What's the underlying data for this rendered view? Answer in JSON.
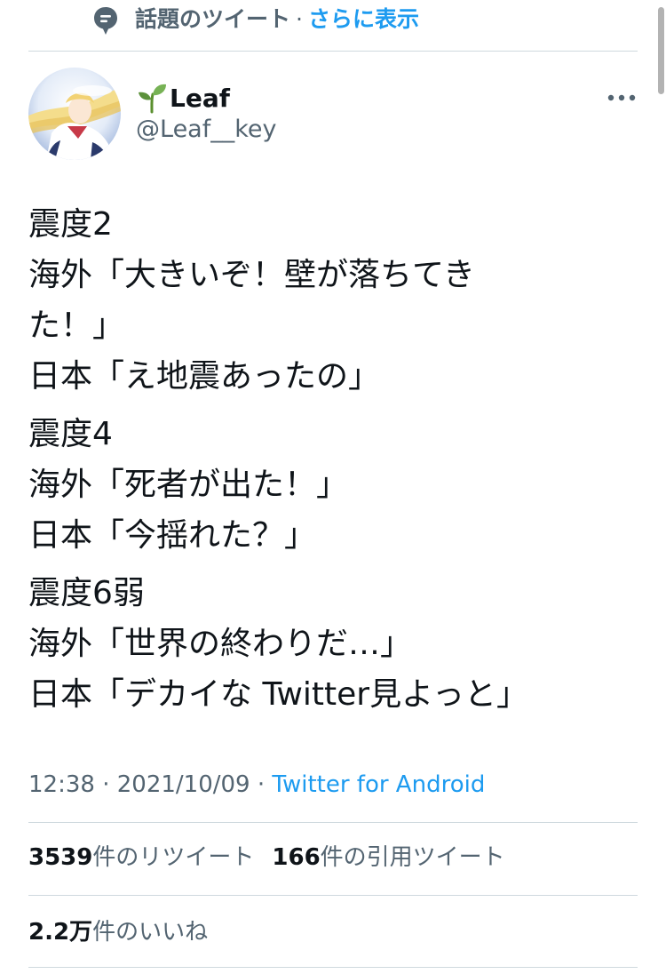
{
  "topic_bar": {
    "label": "話題のツイート",
    "separator": "·",
    "more_link": "さらに表示"
  },
  "author": {
    "display_name": "Leaf",
    "handle": "@Leaf__key",
    "name_emoji": "sprout-icon"
  },
  "tweet": {
    "paragraphs": [
      [
        "震度2",
        "海外「大きいぞ！壁が落ちてき",
        "た！」",
        "日本「え地震あったの」"
      ],
      [
        "震度4",
        "海外「死者が出た！」",
        "日本「今揺れた？」"
      ],
      [
        "震度6弱",
        "海外「世界の終わりだ…」",
        "日本「デカイな Twitter見よっと」"
      ]
    ]
  },
  "meta": {
    "time": "12:38",
    "separator": "·",
    "date": "2021/10/09",
    "source": "Twitter for Android"
  },
  "stats": {
    "retweets_count": "3539",
    "retweets_label": "件のリツイート",
    "quotes_count": "166",
    "quotes_label": "件の引用ツイート",
    "likes_count": "2.2万",
    "likes_label": "件のいいね"
  },
  "colors": {
    "accent": "#1d9bf0",
    "secondary_text": "#536471",
    "primary_text": "#0f1419",
    "divider": "#cfd9de"
  }
}
